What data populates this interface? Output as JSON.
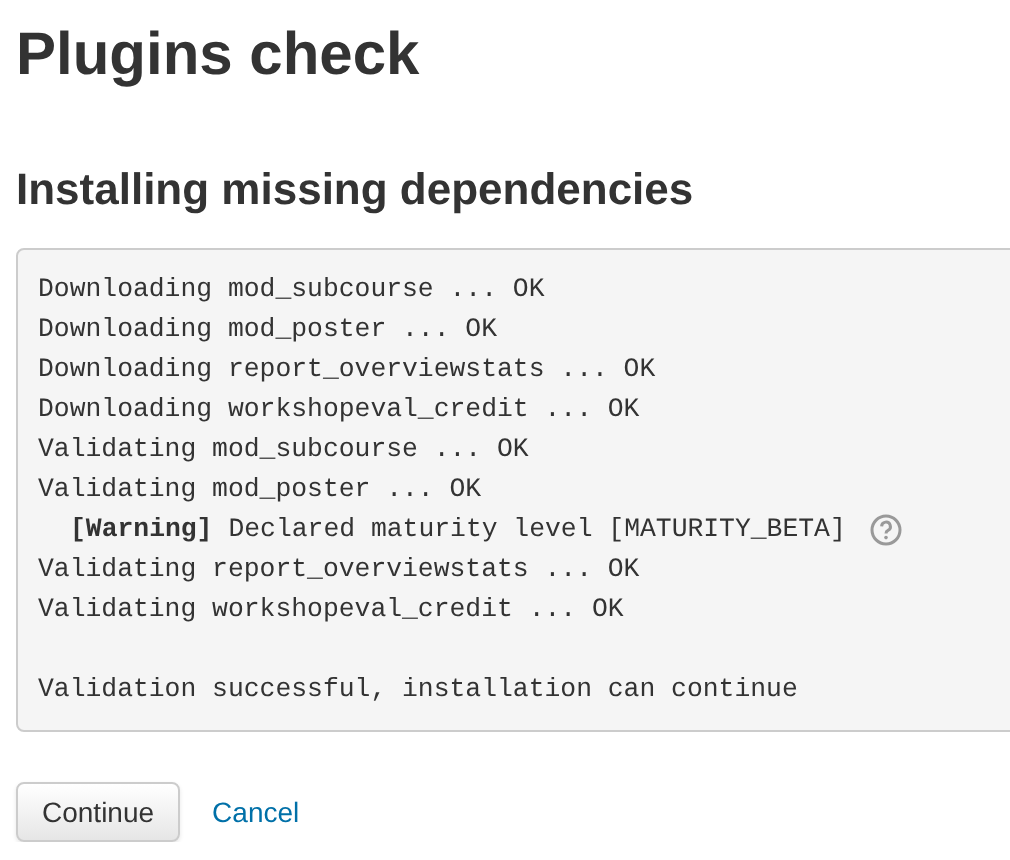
{
  "title": "Plugins check",
  "heading": "Installing missing dependencies",
  "log": [
    {
      "kind": "line",
      "text": "Downloading mod_subcourse ... OK"
    },
    {
      "kind": "line",
      "text": "Downloading mod_poster ... OK"
    },
    {
      "kind": "line",
      "text": "Downloading report_overviewstats ... OK"
    },
    {
      "kind": "line",
      "text": "Downloading workshopeval_credit ... OK"
    },
    {
      "kind": "line",
      "text": "Validating mod_subcourse ... OK"
    },
    {
      "kind": "line",
      "text": "Validating mod_poster ... OK"
    },
    {
      "kind": "warning",
      "label": "[Warning]",
      "text": "Declared maturity level [MATURITY_BETA]"
    },
    {
      "kind": "line",
      "text": "Validating report_overviewstats ... OK"
    },
    {
      "kind": "line",
      "text": "Validating workshopeval_credit ... OK"
    },
    {
      "kind": "blank"
    },
    {
      "kind": "line",
      "text": "Validation successful, installation can continue"
    }
  ],
  "buttons": {
    "continue": "Continue",
    "cancel": "Cancel"
  }
}
